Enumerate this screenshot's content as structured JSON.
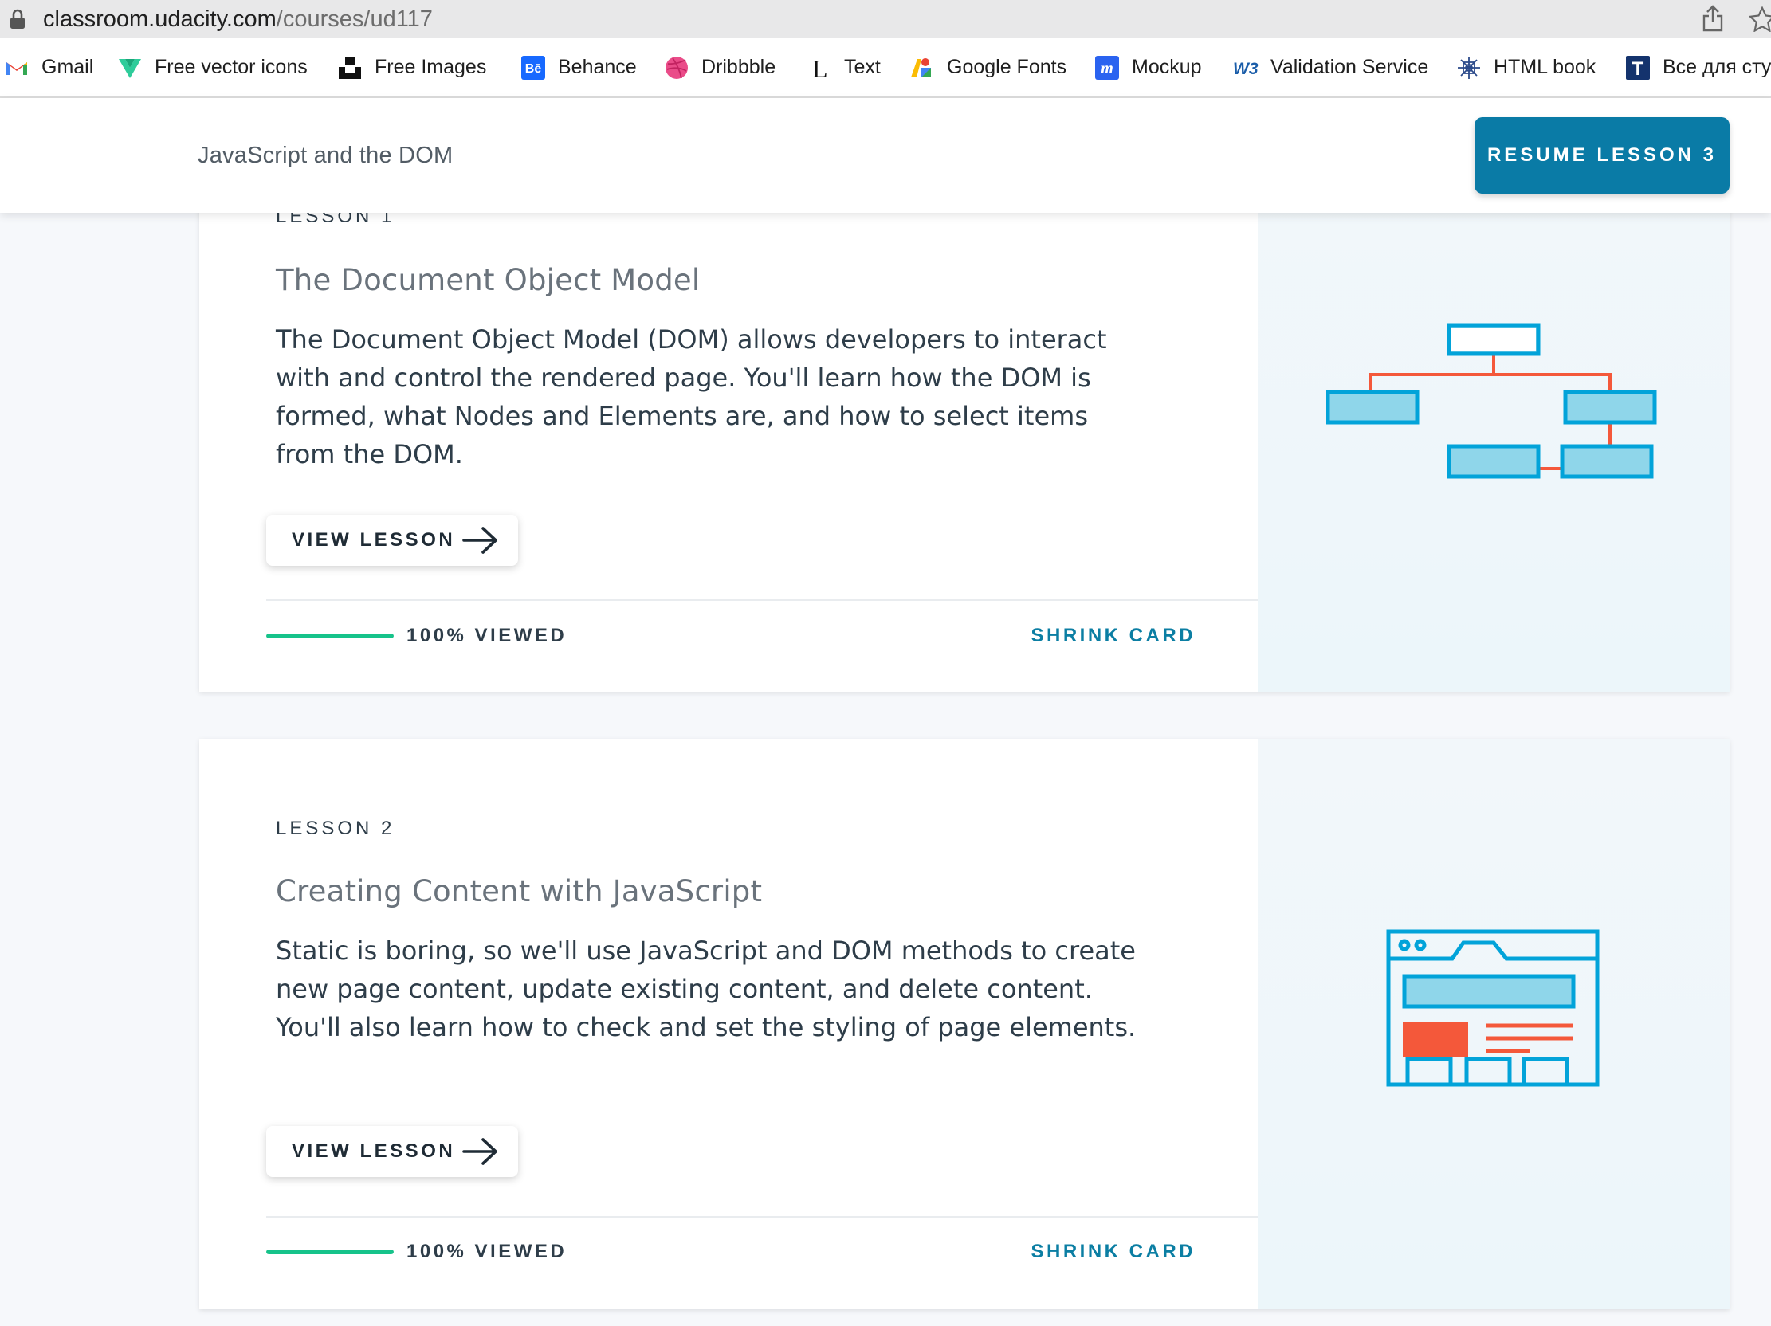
{
  "browser": {
    "url_host": "classroom.udacity.com",
    "url_path": "/courses/ud117",
    "bookmarks": [
      {
        "label": "Gmail",
        "icon": "gmail-icon"
      },
      {
        "label": "Free vector icons",
        "icon": "vector-icon"
      },
      {
        "label": "Free Images",
        "icon": "unsplash-icon"
      },
      {
        "label": "Behance",
        "icon": "behance-icon"
      },
      {
        "label": "Dribbble",
        "icon": "dribbble-icon"
      },
      {
        "label": "Text",
        "icon": "text-icon"
      },
      {
        "label": "Google Fonts",
        "icon": "google-fonts-icon"
      },
      {
        "label": "Mockup",
        "icon": "mockup-icon"
      },
      {
        "label": "Validation Service",
        "icon": "w3c-icon"
      },
      {
        "label": "HTML book",
        "icon": "html-book-icon"
      },
      {
        "label": "Все для сту",
        "icon": "t-icon"
      }
    ]
  },
  "header": {
    "course_title": "JavaScript and the DOM",
    "resume_label": "RESUME LESSON 3"
  },
  "lessons": [
    {
      "label": "LESSON 1",
      "title": "The Document Object Model",
      "description": "The Document Object Model (DOM) allows developers to interact with and control the rendered page. You'll learn how the DOM is formed, what Nodes and Elements are, and how to select items from the DOM.",
      "view_label": "VIEW LESSON",
      "progress_fraction": 1.0,
      "viewed_label": "100% VIEWED",
      "shrink_label": "SHRINK CARD",
      "art_icon": "dom-tree-icon"
    },
    {
      "label": "LESSON 2",
      "title": "Creating Content with JavaScript",
      "description": "Static is boring, so we'll use JavaScript and DOM methods to create new page content, update existing content, and delete content. You'll also learn how to check and set the styling of page elements.",
      "view_label": "VIEW LESSON",
      "progress_fraction": 1.0,
      "viewed_label": "100% VIEWED",
      "shrink_label": "SHRINK CARD",
      "art_icon": "webpage-layout-icon"
    }
  ],
  "colors": {
    "accent": "#0a7ba6",
    "progress": "#16c38a",
    "art_blue": "#02a3d9",
    "art_blue_fill": "#8fd6ea",
    "art_orange": "#f4583a"
  }
}
